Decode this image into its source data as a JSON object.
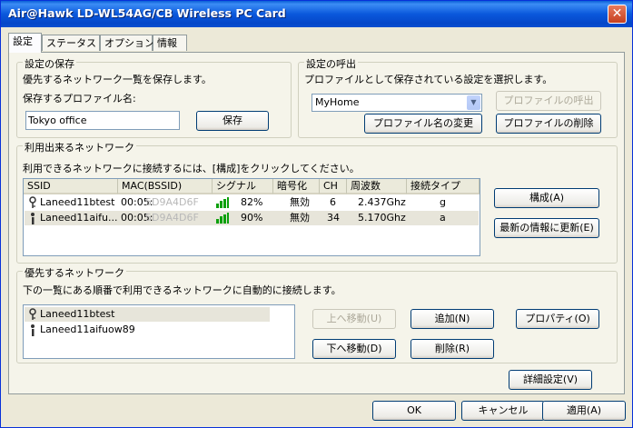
{
  "window": {
    "title": "Air@Hawk LD-WL54AG/CB Wireless PC Card",
    "close_label": "✕"
  },
  "tabs": [
    {
      "label": "設定",
      "active": true
    },
    {
      "label": "ステータス"
    },
    {
      "label": "オプション"
    },
    {
      "label": "情報"
    }
  ],
  "save_group": {
    "title": "設定の保存",
    "description": "優先するネットワーク一覧を保存します。",
    "name_label": "保存するプロファイル名:",
    "name_value": "Tokyo office",
    "save_button": "保存"
  },
  "load_group": {
    "title": "設定の呼出",
    "description": "プロファイルとして保存されている設定を選択します。",
    "selected_profile": "MyHome",
    "load_button": "プロファイルの呼出",
    "rename_button": "プロファイル名の変更",
    "delete_button": "プロファイルの削除"
  },
  "available_group": {
    "title": "利用出来るネットワーク",
    "description": "利用できるネットワークに接続するには、[構成]をクリックしてください。",
    "columns": [
      "SSID",
      "MAC(BSSID)",
      "シグナル",
      "暗号化",
      "CH",
      "周波数",
      "接続タイプ"
    ],
    "rows": [
      {
        "ssid": "Laneed11btest",
        "mac_prefix": "00:05:",
        "mac_hidden": "5D9A4D6F",
        "signal": "82%",
        "encryption": "無効",
        "ch": "6",
        "freq": "2.437Ghz",
        "type": "g",
        "icon": "key-icon"
      },
      {
        "ssid": "Laneed11aifu...",
        "mac_prefix": "00:05:",
        "mac_hidden": "5D9A4D6F",
        "signal": "90%",
        "encryption": "無効",
        "ch": "34",
        "freq": "5.170Ghz",
        "type": "a",
        "icon": "person-icon"
      }
    ],
    "configure_button": "構成(A)",
    "refresh_button": "最新の情報に更新(E)"
  },
  "preferred_group": {
    "title": "優先するネットワーク",
    "description": "下の一覧にある順番で利用できるネットワークに自動的に接続します。",
    "items": [
      {
        "label": "Laneed11btest",
        "icon": "key-icon"
      },
      {
        "label": "Laneed11aifuow89",
        "icon": "person-icon"
      }
    ],
    "move_up_button": "上へ移動(U)",
    "move_down_button": "下へ移動(D)",
    "add_button": "追加(N)",
    "remove_button": "削除(R)",
    "properties_button": "プロパティ(O)"
  },
  "advanced_button": "詳細設定(V)",
  "footer": {
    "ok": "OK",
    "cancel": "キャンセル",
    "apply": "適用(A)"
  }
}
